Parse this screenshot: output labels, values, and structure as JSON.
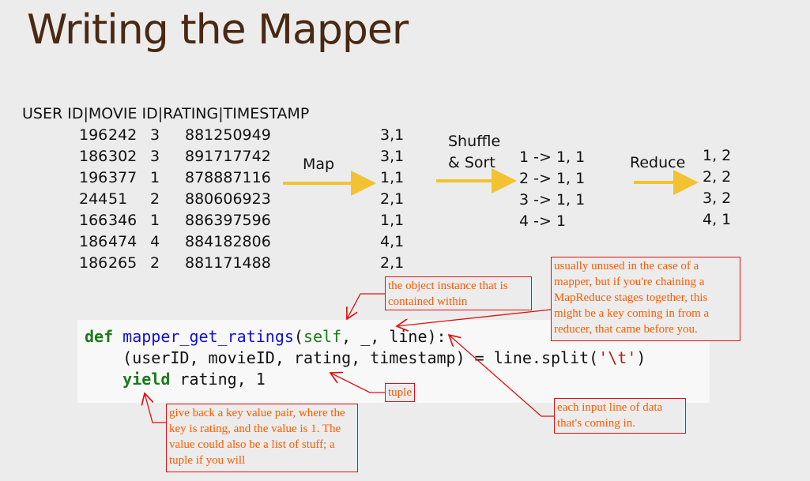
{
  "title": "Writing the Mapper",
  "table": {
    "header": "USER ID|MOVIE ID|RATING|TIMESTAMP",
    "rows": [
      [
        "196",
        "242",
        "3",
        "881250949"
      ],
      [
        "186",
        "302",
        "3",
        "891717742"
      ],
      [
        "196",
        "377",
        "1",
        "878887116"
      ],
      [
        "244",
        "51",
        "2",
        "880606923"
      ],
      [
        "166",
        "346",
        "1",
        "886397596"
      ],
      [
        "186",
        "474",
        "4",
        "884182806"
      ],
      [
        "186",
        "265",
        "2",
        "881171488"
      ]
    ]
  },
  "map": {
    "label": "Map",
    "output": [
      "3,1",
      "3,1",
      "1,1",
      "2,1",
      "1,1",
      "4,1",
      "2,1"
    ]
  },
  "shuffle": {
    "label_line1": "Shuffle",
    "label_line2": "& Sort",
    "output": [
      "1 -> 1, 1",
      "2 -> 1, 1",
      "3 -> 1, 1",
      "4 -> 1"
    ]
  },
  "reduce": {
    "label": "Reduce",
    "output": [
      "1, 2",
      "2, 2",
      "3, 2",
      "4, 1"
    ]
  },
  "code": {
    "l1_def": "def",
    "l1_fn": "mapper_get_ratings",
    "l1_open": "(",
    "l1_self": "self",
    "l1_rest": ", _, line):",
    "l2_a": "    (userID, movieID, rating, timestamp) = line.split(",
    "l2_str": "'\\t'",
    "l2_close": ")",
    "l3_kw": "    yield",
    "l3_rest": " rating, 1"
  },
  "notes": {
    "self": "the object instance that is contained within",
    "underscore": "usually unused in the case of a mapper, but if you're chaining a MapReduce stages together, this might be a key coming in from a reducer, that came before you.",
    "tuple": "tuple",
    "yield": "give back a key value pair, where the key is rating, and the value is 1. The value could also be a list of stuff; a tuple if you will",
    "line": "each input line of data that's coming in."
  },
  "colors": {
    "title": "#4a2812",
    "arrow": "#f2c232",
    "annotation_border": "#e01010",
    "annotation_text": "#ff5a00"
  }
}
